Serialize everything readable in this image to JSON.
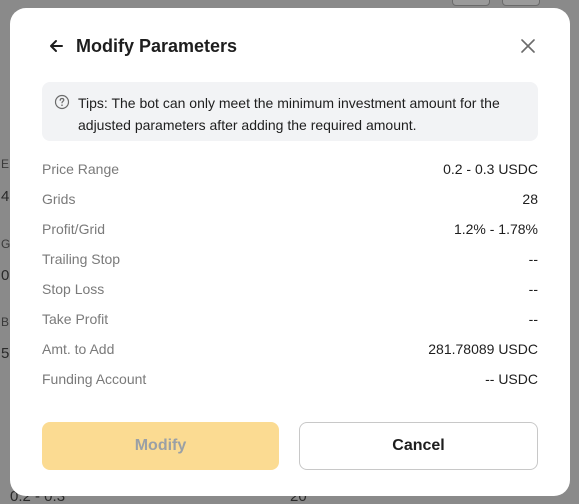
{
  "background": {
    "edge_letters": [
      "E",
      "4",
      "G",
      "0",
      "B",
      "5"
    ],
    "bottom_left": "0.2 - 0.3",
    "bottom_mid": "20"
  },
  "modal": {
    "title": "Modify Parameters",
    "tips": "Tips: The bot can only meet the minimum investment amount for the adjusted parameters after adding the required amount.",
    "params": [
      {
        "label": "Price Range",
        "value": "0.2 - 0.3 USDC"
      },
      {
        "label": "Grids",
        "value": "28"
      },
      {
        "label": "Profit/Grid",
        "value": "1.2% - 1.78%"
      },
      {
        "label": "Trailing Stop",
        "value": "--"
      },
      {
        "label": "Stop Loss",
        "value": "--"
      },
      {
        "label": "Take Profit",
        "value": "--"
      },
      {
        "label": "Amt. to Add",
        "value": "281.78089 USDC"
      },
      {
        "label": "Funding Account",
        "value": "-- USDC"
      }
    ],
    "buttons": {
      "modify": "Modify",
      "cancel": "Cancel"
    }
  },
  "colors": {
    "overlay": "#8a8a8a",
    "modify_button_bg": "#fbdb92",
    "modify_button_text": "#9aa0a6",
    "tips_bg": "#f2f3f5"
  },
  "icons": {
    "back": "arrow-left-icon",
    "close": "close-icon",
    "help": "question-circle-icon"
  }
}
